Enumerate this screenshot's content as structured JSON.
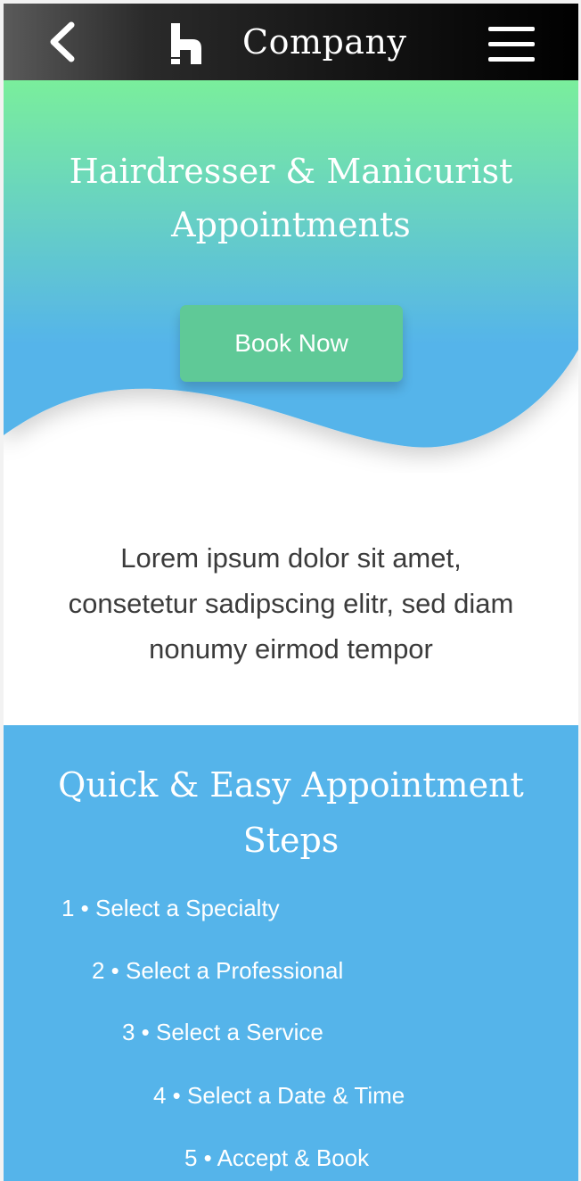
{
  "header": {
    "back_icon": "chevron-left-icon",
    "logo_icon": "company-logo-icon",
    "brand": "Company",
    "menu_icon": "hamburger-menu-icon"
  },
  "hero": {
    "title_line1": "Hairdresser & Manicurist",
    "title_line2": "Appointments",
    "book_button": "Book Now",
    "gradient_top": "#7aee9c",
    "gradient_bottom": "#55b4ea"
  },
  "intro": {
    "line1": "Lorem ipsum dolor sit amet,",
    "line2": "consetetur sadipscing elitr, sed diam",
    "line3": "nonumy eirmod tempor"
  },
  "steps": {
    "title_line1": "Quick & Easy Appointment",
    "title_line2": "Steps",
    "items": [
      "1 • Select a Specialty",
      "2 • Select a Professional",
      "3 • Select a Service",
      "4 • Select a Date & Time",
      "5 • Accept & Book"
    ],
    "background": "#55b4ea"
  },
  "colors": {
    "button_green": "#5fc997",
    "text_dark": "#3b3b3b"
  }
}
